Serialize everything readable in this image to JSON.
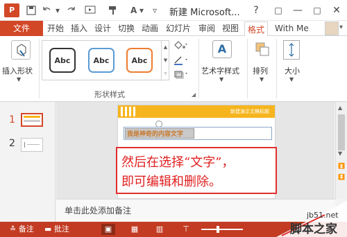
{
  "app": {
    "logo_text": "P",
    "document_title": "新建 Microsoft...",
    "window_buttons": [
      "?",
      "□",
      "—",
      "□",
      "✕"
    ]
  },
  "quick_access": {
    "icons": [
      "save-icon",
      "undo-icon",
      "redo-icon",
      "format-painter-icon",
      "font-color-icon"
    ],
    "font_label": "A"
  },
  "ribbon_tabs": {
    "file": "文件",
    "tabs": [
      "开始",
      "插入",
      "设计",
      "切换",
      "动画",
      "幻灯片",
      "审阅",
      "视图",
      "格式"
    ],
    "active": "格式",
    "user": "With Me"
  },
  "ribbon": {
    "insert_shape": "插入形状",
    "shape_style_swatches": [
      {
        "label": "Abc",
        "border": "#333333"
      },
      {
        "label": "Abc",
        "border": "#5b9bd5"
      },
      {
        "label": "Abc",
        "border": "#ed7d31"
      }
    ],
    "shape_styles_group": "形状样式",
    "wordart_styles": "艺术字样式",
    "arrange": "排列",
    "size": "大小"
  },
  "thumbnails": [
    {
      "num": "1",
      "active": true
    },
    {
      "num": "2",
      "active": false
    }
  ],
  "slide": {
    "header_text": "新建演示文稿标题",
    "text": "我是神奇的内容文字"
  },
  "callout": {
    "line1": "然后在选择“文字”，",
    "line2": "即可编辑和删除。"
  },
  "notes": {
    "placeholder": "单击此处添加备注"
  },
  "statusbar": {
    "notes": "备注",
    "comments": "批注",
    "zoom_fraction": 0.4
  },
  "watermark": {
    "site": "jb51.net",
    "name": "脚本之家"
  },
  "colors": {
    "accent": "#d24726",
    "statusbar": "#c23b22",
    "callout_red": "#e02d2d",
    "slide_header": "#f6b51e"
  }
}
